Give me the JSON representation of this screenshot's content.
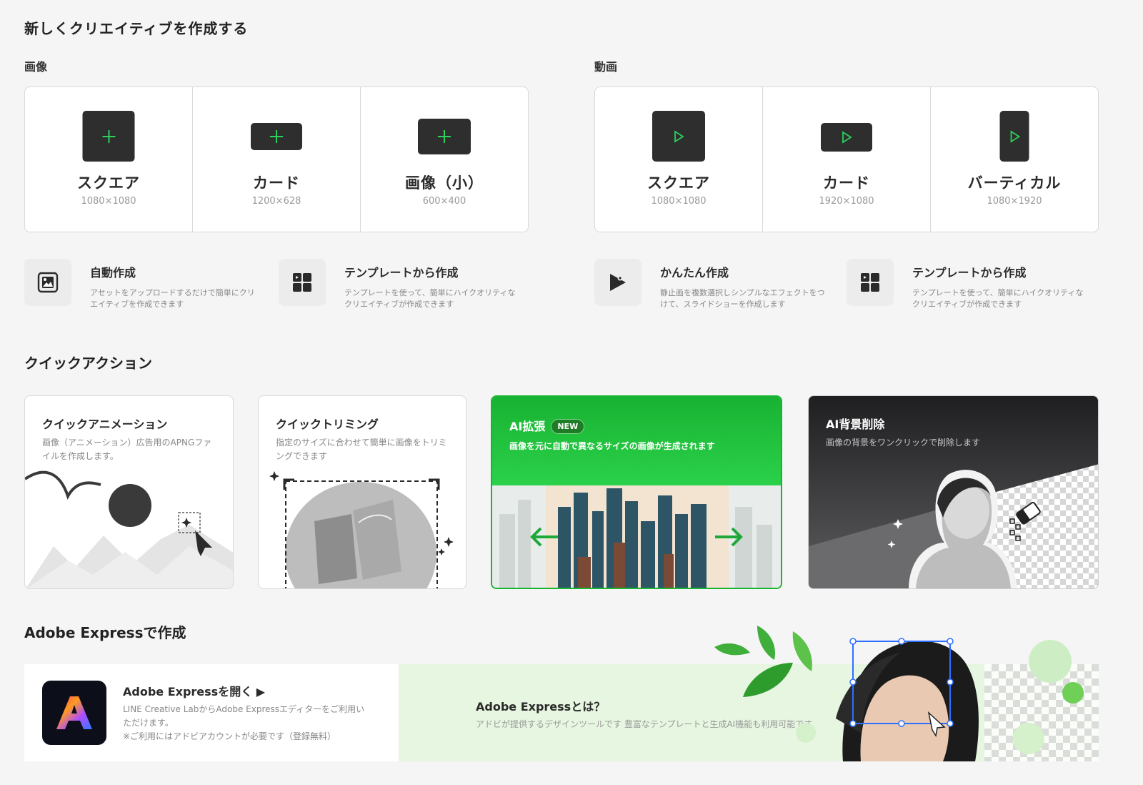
{
  "page": {
    "title": "新しくクリエイティブを作成する"
  },
  "image_section": {
    "label": "画像",
    "cards": [
      {
        "name": "スクエア",
        "dims": "1080×1080",
        "icon": "plus-icon"
      },
      {
        "name": "カード",
        "dims": "1200×628",
        "icon": "plus-icon"
      },
      {
        "name": "画像（小）",
        "dims": "600×400",
        "icon": "plus-icon"
      }
    ]
  },
  "video_section": {
    "label": "動画",
    "cards": [
      {
        "name": "スクエア",
        "dims": "1080×1080",
        "icon": "play-icon"
      },
      {
        "name": "カード",
        "dims": "1920×1080",
        "icon": "play-icon"
      },
      {
        "name": "バーティカル",
        "dims": "1080×1920",
        "icon": "play-icon"
      }
    ]
  },
  "creators": [
    {
      "title": "自動作成",
      "desc": "アセットをアップロードするだけで簡単にクリエイティブを作成できます",
      "icon": "image-frame-icon"
    },
    {
      "title": "テンプレートから作成",
      "desc": "テンプレートを使って、簡単にハイクオリティなクリエイティブが作成できます",
      "icon": "template-grid-icon"
    },
    {
      "title": "かんたん作成",
      "desc": "静止画を複数選択しシンプルなエフェクトをつけて、スライドショーを作成します",
      "icon": "play-sparkle-icon"
    },
    {
      "title": "テンプレートから作成",
      "desc": "テンプレートを使って、簡単にハイクオリティなクリエイティブが作成できます",
      "icon": "template-grid-icon"
    }
  ],
  "quick_actions": {
    "label": "クイックアクション",
    "items": [
      {
        "title": "クイックアニメーション",
        "desc": "画像（アニメーション）広告用のAPNGファイルを作成します。"
      },
      {
        "title": "クイックトリミング",
        "desc": "指定のサイズに合わせて簡単に画像をトリミングできます"
      },
      {
        "title": "AI拡張",
        "badge": "NEW",
        "desc": "画像を元に自動で異なるサイズの画像が生成されます"
      },
      {
        "title": "AI背景削除",
        "desc": "画像の背景をワンクリックで削除します"
      }
    ]
  },
  "adobe": {
    "label": "Adobe Expressで作成",
    "open_title": "Adobe Expressを開く ▶",
    "open_desc": "LINE Creative LabからAdobe Expressエディターをご利用いただけます。",
    "open_note": "※ご利用にはアドビアカウントが必要です（登録無料）",
    "about_title": "Adobe Expressとは？",
    "about_desc": "アドビが提供するデザインツールです 豊富なテンプレートと生成AI機能も利用可能です"
  },
  "colors": {
    "accent_green": "#06c755",
    "icon_dark": "#2e2e2e",
    "ai_green_top": "#19b532",
    "banner_green": "#e6f6e0"
  }
}
